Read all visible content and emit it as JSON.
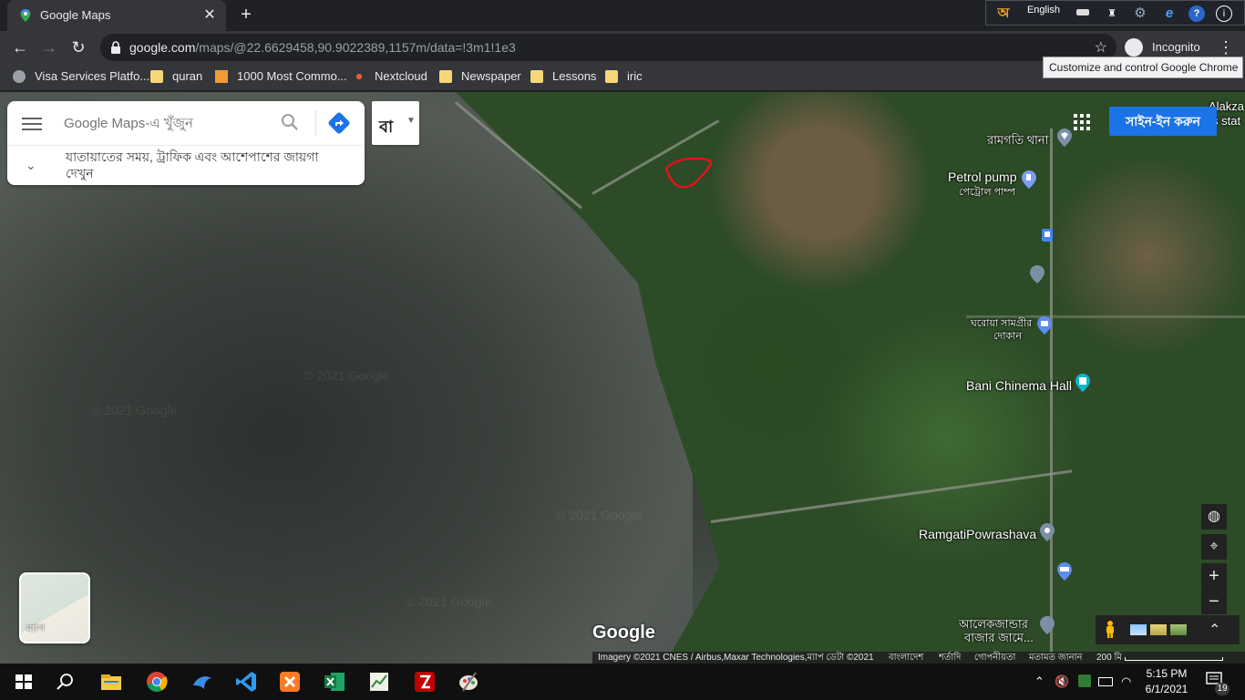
{
  "browser": {
    "tab_title": "Google Maps",
    "new_tab_symbol": "+",
    "tab_close_symbol": "✕",
    "url_host": "google.com",
    "url_path": "/maps/@22.6629458,90.9022389,1157m/data=!3m1!1e3",
    "incognito_label": "Incognito",
    "tooltip": "Customize and control Google Chrome"
  },
  "langbar": {
    "language": "English",
    "keyboard_glyph": "অ"
  },
  "bookmarks": [
    {
      "label": "Visa Services Platfo...",
      "icon": "globe-icon"
    },
    {
      "label": "quran",
      "icon": "folder-icon"
    },
    {
      "label": "1000 Most Commo...",
      "icon": "document-icon"
    },
    {
      "label": "Nextcloud",
      "icon": "nextcloud-icon"
    },
    {
      "label": "Newspaper",
      "icon": "folder-icon"
    },
    {
      "label": "Lessons",
      "icon": "folder-icon"
    },
    {
      "label": "iric",
      "icon": "folder-icon"
    }
  ],
  "maps": {
    "search_placeholder": "Google Maps-এ খুঁজুন",
    "hint": "যাতায়াতের সময়, ট্রাফিক এবং আশেপাশের জায়গা দেখুন",
    "layer_button": "বা",
    "signin": "সাইন-ইন করুন",
    "minimap_label": "ম্যাপ",
    "google_logo": "Google",
    "watermark": "© 2021 Google",
    "poi": [
      {
        "name": "রামগতি থানা"
      },
      {
        "name": "Petrol pump",
        "sub": "পেট্রোল পাম্প"
      },
      {
        "name": "ঘরোয়া সামগ্রীর",
        "sub": "দোকান"
      },
      {
        "name": "Bani Chinema Hall"
      },
      {
        "name": "RamgatiPowrashava"
      },
      {
        "name": "আলেকজান্ডার",
        "sub": "বাজার জামে..."
      },
      {
        "name": "Alakza",
        "sub": "s stat"
      }
    ],
    "footer": {
      "imagery": "Imagery ©2021 CNES / Airbus,Maxar Technologies,ম্যাপ ডেটা ©2021",
      "country": "বাংলাদেশ",
      "terms": "শর্তাদি",
      "privacy": "গোপনীয়তা",
      "feedback": "মতামত জানান",
      "scale": "200 মি"
    },
    "controls": {
      "zoom_in": "+",
      "zoom_out": "−",
      "expand": "⌃"
    }
  },
  "taskbar": {
    "time": "5:15 PM",
    "date": "6/1/2021",
    "notifications": "19"
  },
  "colors": {
    "chrome_dark": "#202124",
    "chrome_toolbar": "#35363a",
    "accent_blue": "#1a73e8",
    "annotation_red": "#e0131b"
  }
}
